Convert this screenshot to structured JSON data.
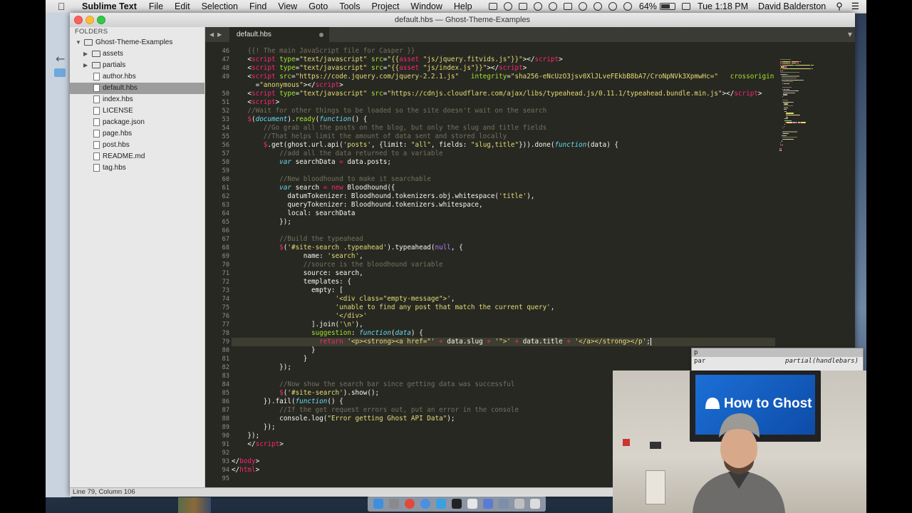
{
  "menubar": {
    "app_name": "Sublime Text",
    "menus": [
      "File",
      "Edit",
      "Selection",
      "Find",
      "View",
      "Goto",
      "Tools",
      "Project",
      "Window",
      "Help"
    ],
    "battery": "64%",
    "clock": "Tue 1:18 PM",
    "user": "David Balderston"
  },
  "window": {
    "title": "default.hbs — Ghost-Theme-Examples"
  },
  "sidebar": {
    "heading": "FOLDERS",
    "root": "Ghost-Theme-Examples",
    "items": [
      {
        "label": "assets",
        "type": "folder"
      },
      {
        "label": "partials",
        "type": "folder"
      },
      {
        "label": "author.hbs",
        "type": "file"
      },
      {
        "label": "default.hbs",
        "type": "file",
        "selected": true
      },
      {
        "label": "index.hbs",
        "type": "file"
      },
      {
        "label": "LICENSE",
        "type": "file"
      },
      {
        "label": "package.json",
        "type": "file"
      },
      {
        "label": "page.hbs",
        "type": "file"
      },
      {
        "label": "post.hbs",
        "type": "file"
      },
      {
        "label": "README.md",
        "type": "file"
      },
      {
        "label": "tag.hbs",
        "type": "file"
      }
    ]
  },
  "tab": {
    "label": "default.hbs"
  },
  "editor": {
    "current_line": 79,
    "lines": [
      {
        "n": "46",
        "tokens": [
          [
            "    ",
            "plain"
          ],
          [
            "{{! The main JavaScript file for Casper }}",
            "comment"
          ]
        ]
      },
      {
        "n": "47",
        "tokens": [
          [
            "    <",
            "plain"
          ],
          [
            "script",
            "tag"
          ],
          [
            " type",
            "attr"
          ],
          [
            "=",
            "plain"
          ],
          [
            "\"text/javascript\"",
            "string"
          ],
          [
            " src",
            "attr"
          ],
          [
            "=",
            "plain"
          ],
          [
            "\"{{",
            "string"
          ],
          [
            "asset",
            "tag"
          ],
          [
            " \"js/jquery.fitvids.js\"}}\"",
            "string"
          ],
          [
            "></",
            "plain"
          ],
          [
            "script",
            "tag"
          ],
          [
            ">",
            "plain"
          ]
        ]
      },
      {
        "n": "48",
        "tokens": [
          [
            "    <",
            "plain"
          ],
          [
            "script",
            "tag"
          ],
          [
            " type",
            "attr"
          ],
          [
            "=",
            "plain"
          ],
          [
            "\"text/javascript\"",
            "string"
          ],
          [
            " src",
            "attr"
          ],
          [
            "=",
            "plain"
          ],
          [
            "\"{{",
            "string"
          ],
          [
            "asset",
            "tag"
          ],
          [
            " \"js/index.js\"}}\"",
            "string"
          ],
          [
            "></",
            "plain"
          ],
          [
            "script",
            "tag"
          ],
          [
            ">",
            "plain"
          ]
        ]
      },
      {
        "n": "49",
        "tokens": [
          [
            "    <",
            "plain"
          ],
          [
            "script",
            "tag"
          ],
          [
            " src",
            "attr"
          ],
          [
            "=",
            "plain"
          ],
          [
            "\"https://code.jquery.com/jquery-2.2.1.js\"",
            "string"
          ],
          [
            "   integrity",
            "attr"
          ],
          [
            "=",
            "plain"
          ],
          [
            "\"sha256-eNcUzO3jsv0XlJLveFEkbB8bA7/CroNpNVk3XpmwHc=\"",
            "string"
          ],
          [
            "   crossorigin",
            "attr"
          ]
        ]
      },
      {
        "n": "",
        "tokens": [
          [
            "      =",
            "plain"
          ],
          [
            "\"anonymous\"",
            "string"
          ],
          [
            "></",
            "plain"
          ],
          [
            "script",
            "tag"
          ],
          [
            ">",
            "plain"
          ]
        ]
      },
      {
        "n": "50",
        "tokens": [
          [
            "    <",
            "plain"
          ],
          [
            "script",
            "tag"
          ],
          [
            " type",
            "attr"
          ],
          [
            "=",
            "plain"
          ],
          [
            "\"text/javascript\"",
            "string"
          ],
          [
            " src",
            "attr"
          ],
          [
            "=",
            "plain"
          ],
          [
            "\"https://cdnjs.cloudflare.com/ajax/libs/typeahead.js/0.11.1/typeahead.bundle.min.js\"",
            "string"
          ],
          [
            "></",
            "plain"
          ],
          [
            "script",
            "tag"
          ],
          [
            ">",
            "plain"
          ]
        ]
      },
      {
        "n": "51",
        "tokens": [
          [
            "    <",
            "plain"
          ],
          [
            "script",
            "tag"
          ],
          [
            ">",
            "plain"
          ]
        ]
      },
      {
        "n": "52",
        "tokens": [
          [
            "    ",
            "plain"
          ],
          [
            "//Wait for other things to be loaded so the site doesn't wait on the search",
            "comment"
          ]
        ]
      },
      {
        "n": "53",
        "tokens": [
          [
            "    ",
            "plain"
          ],
          [
            "$",
            "op"
          ],
          [
            "(",
            "plain"
          ],
          [
            "document",
            "kw"
          ],
          [
            ").",
            "plain"
          ],
          [
            "ready",
            "fn"
          ],
          [
            "(",
            "plain"
          ],
          [
            "function",
            "kw"
          ],
          [
            "() {",
            "plain"
          ]
        ]
      },
      {
        "n": "54",
        "tokens": [
          [
            "        ",
            "plain"
          ],
          [
            "//Go grab all the posts on the blog, but only the slug and title fields",
            "comment"
          ]
        ]
      },
      {
        "n": "55",
        "tokens": [
          [
            "        ",
            "plain"
          ],
          [
            "//That helps limit the amount of data sent and stored locally",
            "comment"
          ]
        ]
      },
      {
        "n": "56",
        "tokens": [
          [
            "        ",
            "plain"
          ],
          [
            "$",
            "op"
          ],
          [
            ".get(ghost.url.api(",
            "plain"
          ],
          [
            "'posts'",
            "string"
          ],
          [
            ", {limit: ",
            "plain"
          ],
          [
            "\"all\"",
            "string"
          ],
          [
            ", fields: ",
            "plain"
          ],
          [
            "\"slug,title\"",
            "string"
          ],
          [
            "})).done(",
            "plain"
          ],
          [
            "function",
            "kw"
          ],
          [
            "(data) {",
            "plain"
          ]
        ]
      },
      {
        "n": "57",
        "tokens": [
          [
            "            ",
            "plain"
          ],
          [
            "//add all the data returned to a variable",
            "comment"
          ]
        ]
      },
      {
        "n": "58",
        "tokens": [
          [
            "            ",
            "plain"
          ],
          [
            "var",
            "kw"
          ],
          [
            " searchData ",
            "plain"
          ],
          [
            "=",
            "op"
          ],
          [
            " data.posts;",
            "plain"
          ]
        ]
      },
      {
        "n": "59",
        "tokens": [
          [
            "",
            "plain"
          ]
        ]
      },
      {
        "n": "60",
        "tokens": [
          [
            "            ",
            "plain"
          ],
          [
            "//New bloodhound to make it searchable",
            "comment"
          ]
        ]
      },
      {
        "n": "61",
        "tokens": [
          [
            "            ",
            "plain"
          ],
          [
            "var",
            "kw"
          ],
          [
            " search ",
            "plain"
          ],
          [
            "=",
            "op"
          ],
          [
            " ",
            "plain"
          ],
          [
            "new",
            "op"
          ],
          [
            " Bloodhound({",
            "plain"
          ]
        ]
      },
      {
        "n": "62",
        "tokens": [
          [
            "              datumTokenizer: Bloodhound.tokenizers.obj.whitespace(",
            "plain"
          ],
          [
            "'title'",
            "string"
          ],
          [
            "),",
            "plain"
          ]
        ]
      },
      {
        "n": "63",
        "tokens": [
          [
            "              queryTokenizer: Bloodhound.tokenizers.whitespace,",
            "plain"
          ]
        ]
      },
      {
        "n": "64",
        "tokens": [
          [
            "              local: searchData",
            "plain"
          ]
        ]
      },
      {
        "n": "65",
        "tokens": [
          [
            "            });",
            "plain"
          ]
        ]
      },
      {
        "n": "66",
        "tokens": [
          [
            "",
            "plain"
          ]
        ]
      },
      {
        "n": "67",
        "tokens": [
          [
            "            ",
            "plain"
          ],
          [
            "//Build the typeahead",
            "comment"
          ]
        ]
      },
      {
        "n": "68",
        "tokens": [
          [
            "            ",
            "plain"
          ],
          [
            "$",
            "op"
          ],
          [
            "(",
            "plain"
          ],
          [
            "'#site-search .typeahead'",
            "string"
          ],
          [
            ").typeahead(",
            "plain"
          ],
          [
            "null",
            "const"
          ],
          [
            ", {",
            "plain"
          ]
        ]
      },
      {
        "n": "69",
        "tokens": [
          [
            "                  name: ",
            "plain"
          ],
          [
            "'search'",
            "string"
          ],
          [
            ",",
            "plain"
          ]
        ]
      },
      {
        "n": "70",
        "tokens": [
          [
            "                  ",
            "plain"
          ],
          [
            "//source is the bloodhound variable",
            "comment"
          ]
        ]
      },
      {
        "n": "71",
        "tokens": [
          [
            "                  source: search,",
            "plain"
          ]
        ]
      },
      {
        "n": "72",
        "tokens": [
          [
            "                  templates: {",
            "plain"
          ]
        ]
      },
      {
        "n": "73",
        "tokens": [
          [
            "                    empty: [",
            "plain"
          ]
        ]
      },
      {
        "n": "74",
        "tokens": [
          [
            "                          ",
            "plain"
          ],
          [
            "'<div class=\"empty-message\">'",
            "string"
          ],
          [
            ",",
            "plain"
          ]
        ]
      },
      {
        "n": "75",
        "tokens": [
          [
            "                          ",
            "plain"
          ],
          [
            "'unable to find any post that match the current query'",
            "string"
          ],
          [
            ",",
            "plain"
          ]
        ]
      },
      {
        "n": "76",
        "tokens": [
          [
            "                          ",
            "plain"
          ],
          [
            "'</div>'",
            "string"
          ]
        ]
      },
      {
        "n": "77",
        "tokens": [
          [
            "                    ].join(",
            "plain"
          ],
          [
            "'\\n'",
            "string"
          ],
          [
            "),",
            "plain"
          ]
        ]
      },
      {
        "n": "78",
        "tokens": [
          [
            "                    ",
            "plain"
          ],
          [
            "suggestion",
            "fn"
          ],
          [
            ": ",
            "plain"
          ],
          [
            "function",
            "kw"
          ],
          [
            "(",
            "plain"
          ],
          [
            "data",
            "kw"
          ],
          [
            ") {",
            "plain"
          ]
        ]
      },
      {
        "n": "79",
        "tokens": [
          [
            "                      ",
            "plain"
          ],
          [
            "return",
            "op"
          ],
          [
            " ",
            "plain"
          ],
          [
            "'<p><strong><a href=\"'",
            "string"
          ],
          [
            " ",
            "plain"
          ],
          [
            "+",
            "op"
          ],
          [
            " data.slug ",
            "plain"
          ],
          [
            "+",
            "op"
          ],
          [
            " ",
            "plain"
          ],
          [
            "'\">'",
            "string"
          ],
          [
            " ",
            "plain"
          ],
          [
            "+",
            "op"
          ],
          [
            " data.title ",
            "plain"
          ],
          [
            "+",
            "op"
          ],
          [
            " ",
            "plain"
          ],
          [
            "'</a></strong></p'",
            "string"
          ],
          [
            ";",
            "plain"
          ]
        ]
      },
      {
        "n": "80",
        "tokens": [
          [
            "                    }",
            "plain"
          ]
        ]
      },
      {
        "n": "81",
        "tokens": [
          [
            "                  }",
            "plain"
          ]
        ]
      },
      {
        "n": "82",
        "tokens": [
          [
            "            });",
            "plain"
          ]
        ]
      },
      {
        "n": "83",
        "tokens": [
          [
            "",
            "plain"
          ]
        ]
      },
      {
        "n": "84",
        "tokens": [
          [
            "            ",
            "plain"
          ],
          [
            "//Now show the search bar since getting data was successful",
            "comment"
          ]
        ]
      },
      {
        "n": "85",
        "tokens": [
          [
            "            ",
            "plain"
          ],
          [
            "$",
            "op"
          ],
          [
            "(",
            "plain"
          ],
          [
            "'#site-search'",
            "string"
          ],
          [
            ").show();",
            "plain"
          ]
        ]
      },
      {
        "n": "86",
        "tokens": [
          [
            "        }).fail(",
            "plain"
          ],
          [
            "function",
            "kw"
          ],
          [
            "() {",
            "plain"
          ]
        ]
      },
      {
        "n": "87",
        "tokens": [
          [
            "            ",
            "plain"
          ],
          [
            "//If the get request errors out, put an error in the console",
            "comment"
          ]
        ]
      },
      {
        "n": "88",
        "tokens": [
          [
            "            console.log(",
            "plain"
          ],
          [
            "\"Error getting Ghost API Data\"",
            "string"
          ],
          [
            ");",
            "plain"
          ]
        ]
      },
      {
        "n": "89",
        "tokens": [
          [
            "        });",
            "plain"
          ]
        ]
      },
      {
        "n": "90",
        "tokens": [
          [
            "    });",
            "plain"
          ]
        ]
      },
      {
        "n": "91",
        "tokens": [
          [
            "    </",
            "plain"
          ],
          [
            "script",
            "tag"
          ],
          [
            ">",
            "plain"
          ]
        ]
      },
      {
        "n": "92",
        "tokens": [
          [
            "",
            "plain"
          ]
        ]
      },
      {
        "n": "93",
        "tokens": [
          [
            "</",
            "plain"
          ],
          [
            "body",
            "tag"
          ],
          [
            ">",
            "plain"
          ]
        ]
      },
      {
        "n": "94",
        "tokens": [
          [
            "</",
            "plain"
          ],
          [
            "html",
            "tag"
          ],
          [
            ">",
            "plain"
          ]
        ]
      },
      {
        "n": "95",
        "tokens": [
          [
            "",
            "plain"
          ]
        ]
      }
    ]
  },
  "autocomplete": {
    "items": [
      {
        "trigger": "p",
        "hint": "",
        "selected": true
      },
      {
        "trigger": "par",
        "hint": "partial(handlebars)",
        "selected": false
      }
    ]
  },
  "statusbar": {
    "position": "Line 79, Column 106"
  },
  "webcam": {
    "tv_text": "How to Ghost"
  },
  "colors": {
    "editor_bg": "#272822",
    "comment": "#75715e",
    "tag": "#f92672",
    "attr": "#a6e22e",
    "string": "#e6db74",
    "keyword": "#66d9ef",
    "sidebar_selected": "#9c9c9c",
    "ghost_blue": "#1c6fd6"
  }
}
